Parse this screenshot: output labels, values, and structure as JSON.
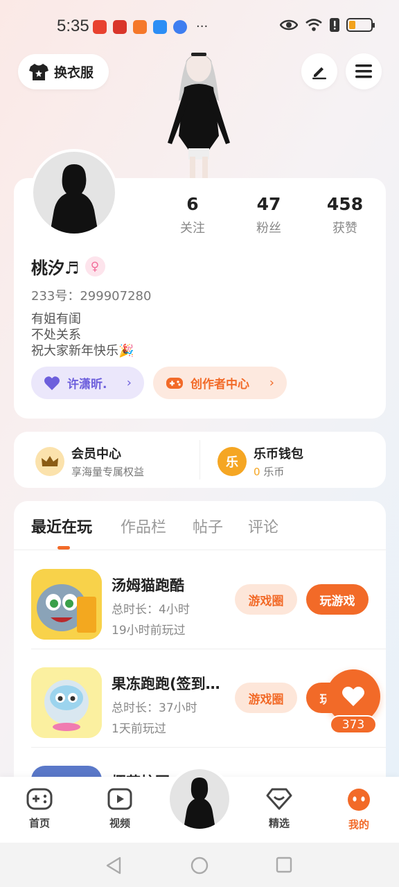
{
  "status_bar": {
    "time": "5:35",
    "more": "···"
  },
  "header": {
    "dress_label": "换衣服"
  },
  "profile": {
    "stats": [
      {
        "value": "6",
        "label": "关注"
      },
      {
        "value": "47",
        "label": "粉丝"
      },
      {
        "value": "458",
        "label": "获赞"
      }
    ],
    "nickname": "桃汐♬",
    "uid_label": "233号：",
    "uid": "299907280",
    "bio_lines": [
      "有姐有闺",
      "不处关系",
      "祝大家新年快乐🎉"
    ],
    "friend_pill": "许潇昕.",
    "creator_pill": "创作者中心"
  },
  "wallet": {
    "member_title": "会员中心",
    "member_sub": "享海量专属权益",
    "coin_title": "乐币钱包",
    "coin_count": "0",
    "coin_unit": " 乐币"
  },
  "tabs": [
    "最近在玩",
    "作品栏",
    "帖子",
    "评论"
  ],
  "games": [
    {
      "name": "汤姆猫跑酷",
      "duration": "总时长：4小时",
      "last_played": "19小时前玩过",
      "circle_btn": "游戏圈",
      "play_btn": "玩游戏"
    },
    {
      "name": "果冻跑跑(签到…",
      "duration": "总时长：37小时",
      "last_played": "1天前玩过",
      "circle_btn": "游戏圈",
      "play_btn": "玩游戏"
    },
    {
      "name": "樱花校园"
    }
  ],
  "like": {
    "count": "373"
  },
  "bottom_nav": {
    "home": "首页",
    "video": "视频",
    "featured": "精选",
    "mine": "我的"
  },
  "colors": {
    "accent": "#f26a28",
    "purple": "#6d5fdc",
    "gold": "#f5a623"
  },
  "battery_level": 0.3
}
